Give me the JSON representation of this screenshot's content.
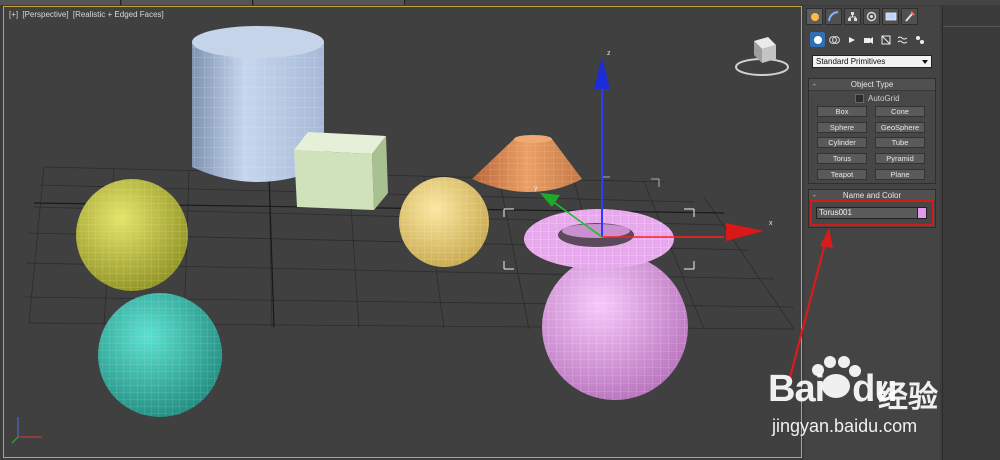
{
  "viewport": {
    "label_parts": [
      "[+]",
      "[Perspective]",
      "[Realistic + Edged Faces]"
    ],
    "axis_labels": {
      "x": "x",
      "y": "y",
      "z": "z"
    }
  },
  "command_panel": {
    "tabs": [
      "create",
      "modify",
      "hierarchy",
      "motion",
      "display",
      "utilities"
    ],
    "active_tab": "create",
    "subcategories": [
      "geometry",
      "shapes",
      "lights",
      "cameras",
      "helpers",
      "space-warps",
      "systems"
    ],
    "dropdown_value": "Standard Primitives",
    "object_type": {
      "title": "Object Type",
      "autogrid_label": "AutoGrid",
      "buttons": [
        "Box",
        "Cone",
        "Sphere",
        "GeoSphere",
        "Cylinder",
        "Tube",
        "Torus",
        "Pyramid",
        "Teapot",
        "Plane"
      ]
    },
    "name_and_color": {
      "title": "Name and Color",
      "name_value": "Torus001",
      "color": "#e39be9"
    },
    "rollout_minus": "-"
  },
  "colors": {
    "viewport_border": "#c9a23a",
    "highlight": "#d11b1b",
    "cylinder": "#b6c8e4",
    "box": "#cfe2bc",
    "cone": "#e2925a",
    "sphere_yellow": "#c8c846",
    "sphere_gold": "#e8cf78",
    "sphere_teal": "#3ec0b0",
    "torus": "#e8a8ee",
    "sphere_pink": "#e6a6ec"
  },
  "watermark": {
    "brand_a": "Bai",
    "brand_b": "du",
    "brand_cn": "经验",
    "url": "jingyan.baidu.com"
  }
}
